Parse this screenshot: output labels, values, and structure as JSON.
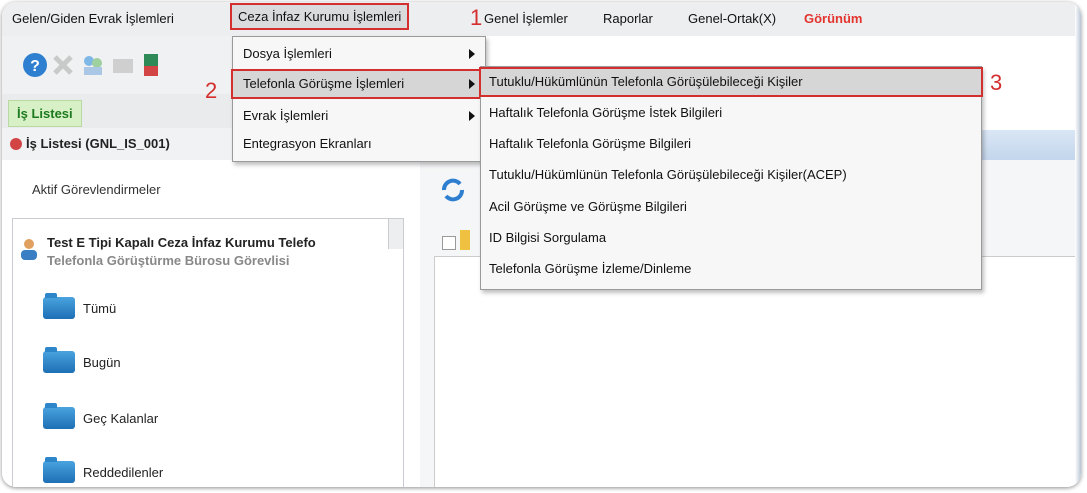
{
  "menubar": {
    "items": [
      "Gelen/Giden Evrak İşlemleri",
      "Ceza İnfaz Kurumu İşlemleri",
      "Genel İşlemler",
      "Raporlar",
      "Genel-Ortak(X)",
      "Görünüm"
    ]
  },
  "tabs": {
    "is_listesi": "İş Listesi",
    "is_listesi_sub": "İş Listesi (GNL_IS_001)"
  },
  "left_panel": {
    "aktif": "Aktif Görevlendirmeler",
    "tree_title": "Test E Tipi Kapalı Ceza İnfaz Kurumu Telefo",
    "tree_subtitle": "Telefonla Görüştürme Bürosu Görevlisi",
    "nodes": [
      "Tümü",
      "Bugün",
      "Geç Kalanlar",
      "Reddedilenler"
    ]
  },
  "main_menu": {
    "items": [
      "Dosya İşlemleri",
      "Telefonla Görüşme İşlemleri",
      "Evrak İşlemleri",
      "Entegrasyon Ekranları"
    ]
  },
  "submenu": {
    "items": [
      "Tutuklu/Hükümlünün Telefonla Görüşülebileceği Kişiler",
      "Haftalık Telefonla Görüşme İstek Bilgileri",
      "Haftalık Telefonla Görüşme Bilgileri",
      "Tutuklu/Hükümlünün Telefonla Görüşülebileceği Kişiler(ACEP)",
      "Acil Görüşme ve Görüşme Bilgileri",
      "ID Bilgisi Sorgulama",
      "Telefonla Görüşme İzleme/Dinleme"
    ]
  },
  "callouts": [
    "1",
    "2",
    "3"
  ],
  "colors": {
    "highlight": "#d32f2f",
    "red_menu": "#e3342f"
  }
}
